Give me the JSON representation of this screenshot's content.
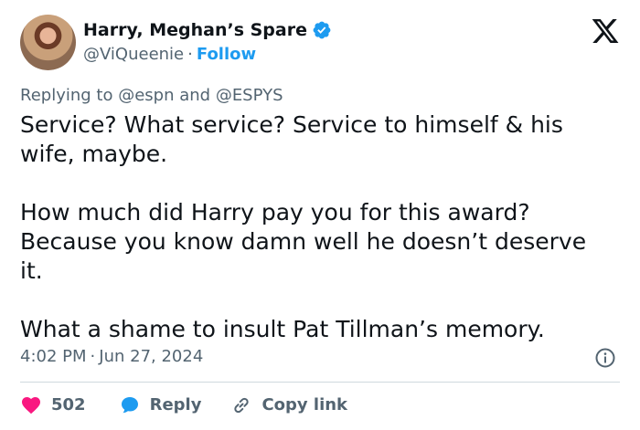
{
  "account": {
    "display_name": "Harry, Meghan’s Spare",
    "handle": "@ViQueenie",
    "separator": "·",
    "follow_label": "Follow"
  },
  "reply_context": {
    "prefix": "Replying to ",
    "mention_1": "@espn",
    "conjunction": " and ",
    "mention_2": "@ESPYS"
  },
  "tweet": {
    "paragraphs": [
      "Service? What service? Service to himself & his\nwife, maybe.",
      "How much did Harry pay you for this award?\nBecause you know damn well he doesn’t deserve\nit.",
      "What a shame to insult Pat Tillman’s memory."
    ],
    "time": "4:02 PM",
    "date_separator": "·",
    "date": "Jun 27, 2024"
  },
  "actions": {
    "like_count": "502",
    "reply_label": "Reply",
    "copy_label": "Copy link"
  },
  "icons": {
    "brand": "x-logo-icon",
    "verified": "verified-badge-icon",
    "info": "info-icon",
    "like": "heart-icon",
    "reply": "speech-bubble-icon",
    "copy": "link-icon"
  },
  "colors": {
    "accent": "#1d9bf0",
    "like": "#f91880",
    "muted": "#536471",
    "text": "#0f1419"
  }
}
